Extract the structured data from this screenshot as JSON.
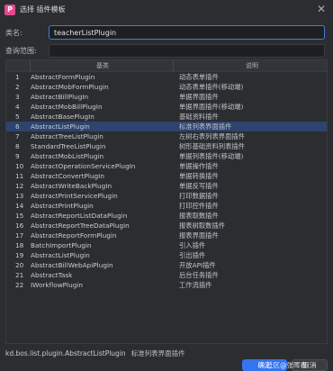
{
  "window": {
    "title": "选择 插件模板",
    "close_glyph": "✕",
    "app_icon_letter": "P"
  },
  "form": {
    "class_label": "类名:",
    "class_value": "teacherListPlugin",
    "scope_label": "查询范围:",
    "scope_value": ""
  },
  "table": {
    "headers": [
      "基类",
      "说明"
    ],
    "selected_index": 5,
    "rows": [
      {
        "num": "1",
        "name": "AbstractFormPlugin",
        "desc": "动态表单插件"
      },
      {
        "num": "2",
        "name": "AbstractMobFormPlugin",
        "desc": "动态表单插件(移动端)"
      },
      {
        "num": "3",
        "name": "AbstractBillPlugIn",
        "desc": "单据界面插件"
      },
      {
        "num": "4",
        "name": "AbstractMobBillPlugIn",
        "desc": "单据界面插件(移动端)"
      },
      {
        "num": "5",
        "name": "AbstractBasePlugIn",
        "desc": "基础资料插件"
      },
      {
        "num": "6",
        "name": "AbstractListPlugin",
        "desc": "标准列表界面插件"
      },
      {
        "num": "7",
        "name": "AbstractTreeListPlugin",
        "desc": "左树右表列表界面插件"
      },
      {
        "num": "8",
        "name": "StandardTreeListPlugin",
        "desc": "树形基础资料列表插件"
      },
      {
        "num": "9",
        "name": "AbstractMobListPlugin",
        "desc": "单据列表插件(移动端)"
      },
      {
        "num": "10",
        "name": "AbstractOperationServicePlugIn",
        "desc": "单据操作插件"
      },
      {
        "num": "11",
        "name": "AbstractConvertPlugIn",
        "desc": "单据转换插件"
      },
      {
        "num": "12",
        "name": "AbstractWriteBackPlugIn",
        "desc": "单据反写插件"
      },
      {
        "num": "13",
        "name": "AbstractPrintServicePlugin",
        "desc": "打印数据插件"
      },
      {
        "num": "14",
        "name": "AbstractPrintPlugin",
        "desc": "打印控件插件"
      },
      {
        "num": "15",
        "name": "AbstractReportListDataPlugin",
        "desc": "报表取数插件"
      },
      {
        "num": "16",
        "name": "AbstractReportTreeDataPlugin",
        "desc": "报表树取数插件"
      },
      {
        "num": "17",
        "name": "AbstractReportFormPlugin",
        "desc": "报表界面插件"
      },
      {
        "num": "18",
        "name": "BatchImportPlugin",
        "desc": "引入插件"
      },
      {
        "num": "19",
        "name": "AbstractListPlugin",
        "desc": "引出插件"
      },
      {
        "num": "20",
        "name": "AbstractBillWebApiPlugin",
        "desc": "开放API插件"
      },
      {
        "num": "21",
        "name": "AbstractTask",
        "desc": "后台任务插件"
      },
      {
        "num": "22",
        "name": "IWorkflowPlugin",
        "desc": "工作流插件"
      }
    ]
  },
  "footer": {
    "path": "kd.bos.list.plugin.AbstractListPlugin",
    "desc": "标准列表界面插件",
    "ok_label": "确定",
    "cancel_label": "取消",
    "watermark": "社区@张晖春"
  }
}
